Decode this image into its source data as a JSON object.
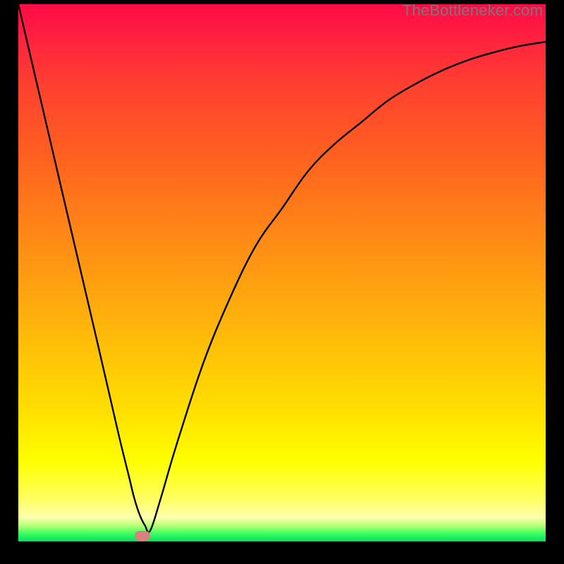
{
  "watermark": "TheBottleneker.com",
  "chart_data": {
    "type": "line",
    "title": "",
    "xlabel": "",
    "ylabel": "",
    "xlim": [
      0,
      100
    ],
    "ylim": [
      0,
      100
    ],
    "grid": false,
    "series": [
      {
        "name": "curve",
        "x": [
          0,
          5,
          10,
          15,
          19,
          21,
          22,
          23,
          24,
          25,
          27,
          30,
          35,
          40,
          45,
          50,
          55,
          60,
          65,
          70,
          75,
          80,
          85,
          90,
          95,
          100
        ],
        "y": [
          100,
          79,
          58,
          37,
          20,
          12,
          8,
          5,
          3,
          2,
          8,
          18,
          33,
          45,
          55,
          62,
          69,
          74,
          78,
          82,
          85,
          87.5,
          89.5,
          91,
          92.2,
          93
        ]
      }
    ],
    "marker": {
      "x": 23.5,
      "y": 1,
      "color": "#d98080"
    },
    "gradient_stops": [
      {
        "pos": 0,
        "color": "#ff0a46"
      },
      {
        "pos": 1,
        "color": "#00e060"
      }
    ]
  }
}
